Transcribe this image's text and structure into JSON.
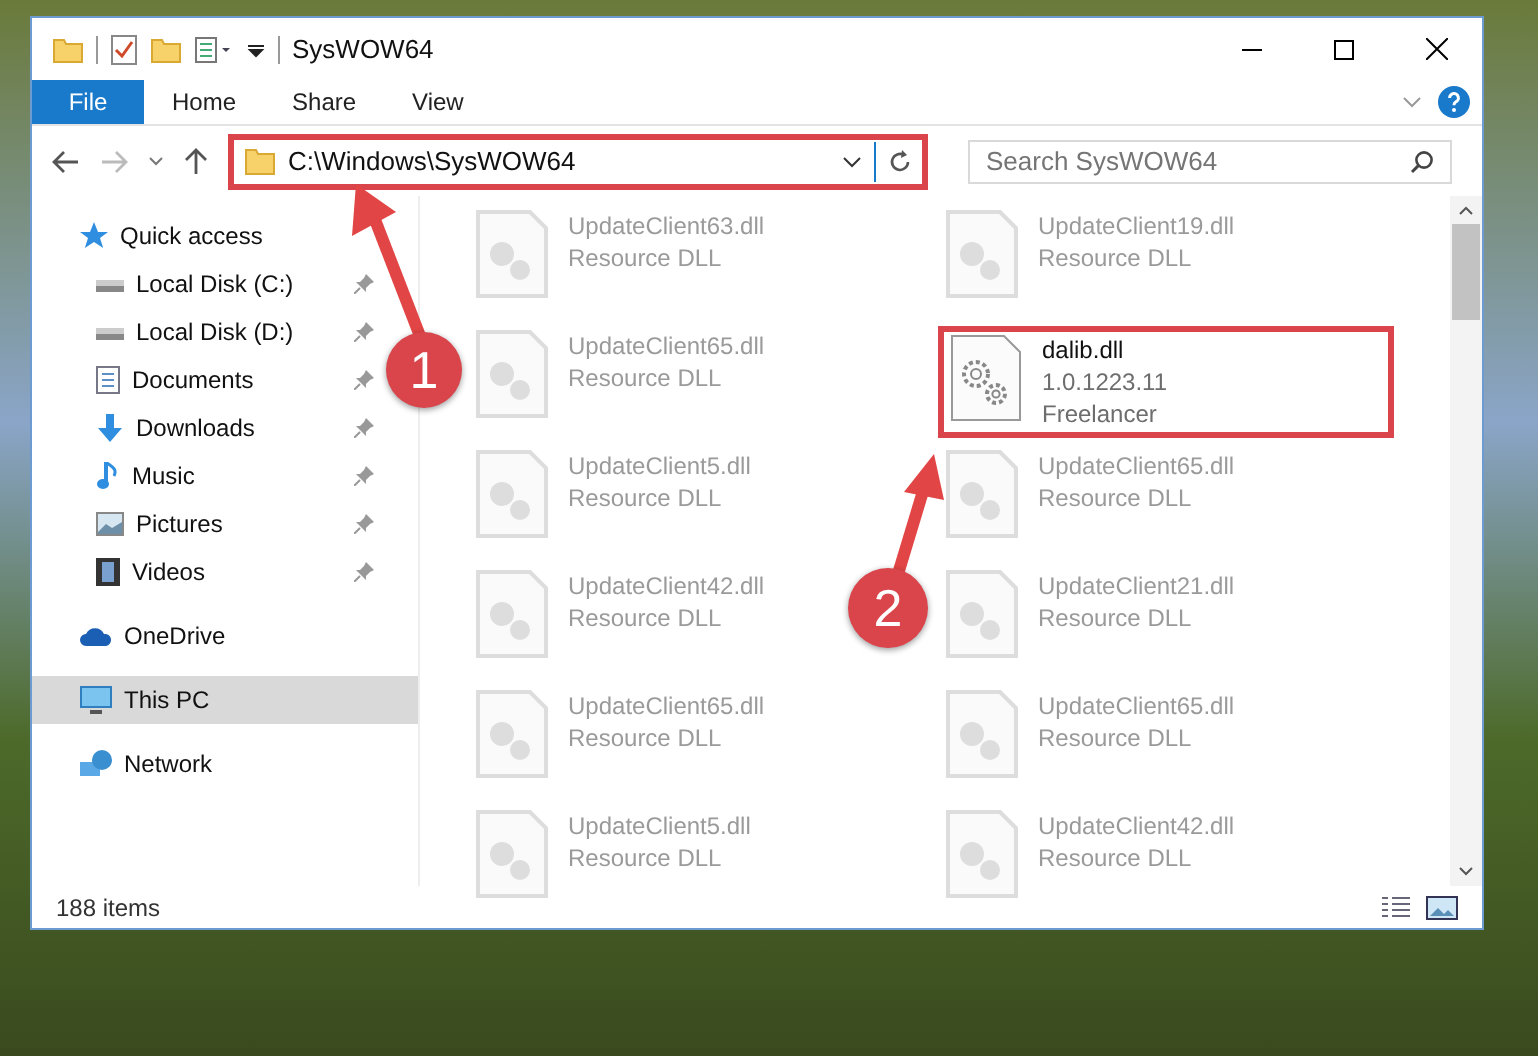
{
  "window": {
    "title": "SysWOW64"
  },
  "ribbon_tabs": [
    {
      "label": "File",
      "selected": true
    },
    {
      "label": "Home",
      "selected": false
    },
    {
      "label": "Share",
      "selected": false
    },
    {
      "label": "View",
      "selected": false
    }
  ],
  "address": {
    "path": "C:\\Windows\\SysWOW64",
    "highlighted": true
  },
  "search": {
    "placeholder": "Search SysWOW64"
  },
  "sidebar": {
    "items": [
      {
        "label": "Quick access",
        "selected": false,
        "children": [
          {
            "label": "Local Disk (C:)",
            "pinned": true
          },
          {
            "label": "Local Disk (D:)",
            "pinned": true
          },
          {
            "label": "Documents",
            "pinned": true
          },
          {
            "label": "Downloads",
            "pinned": true
          },
          {
            "label": "Music",
            "pinned": true
          },
          {
            "label": "Pictures",
            "pinned": true
          },
          {
            "label": "Videos",
            "pinned": true
          }
        ]
      },
      {
        "label": "OneDrive",
        "selected": false
      },
      {
        "label": "This PC",
        "selected": true
      },
      {
        "label": "Network",
        "selected": false
      }
    ]
  },
  "files": [
    {
      "name": "UpdateClient63.dll",
      "details": [
        "Resource DLL"
      ],
      "kind": "resource",
      "highlighted": false
    },
    {
      "name": "UpdateClient19.dll",
      "details": [
        "Resource DLL"
      ],
      "kind": "resource",
      "highlighted": false
    },
    {
      "name": "UpdateClient65.dll",
      "details": [
        "Resource DLL"
      ],
      "kind": "resource",
      "highlighted": false
    },
    {
      "name": "dalib.dll",
      "details": [
        "1.0.1223.11",
        "Freelancer"
      ],
      "kind": "gears",
      "highlighted": true
    },
    {
      "name": "UpdateClient5.dll",
      "details": [
        "Resource DLL"
      ],
      "kind": "resource",
      "highlighted": false
    },
    {
      "name": "UpdateClient65.dll",
      "details": [
        "Resource DLL"
      ],
      "kind": "resource",
      "highlighted": false
    },
    {
      "name": "UpdateClient42.dll",
      "details": [
        "Resource DLL"
      ],
      "kind": "resource",
      "highlighted": false
    },
    {
      "name": "UpdateClient21.dll",
      "details": [
        "Resource DLL"
      ],
      "kind": "resource",
      "highlighted": false
    },
    {
      "name": "UpdateClient65.dll",
      "details": [
        "Resource DLL"
      ],
      "kind": "resource",
      "highlighted": false
    },
    {
      "name": "UpdateClient65.dll",
      "details": [
        "Resource DLL"
      ],
      "kind": "resource",
      "highlighted": false
    },
    {
      "name": "UpdateClient5.dll",
      "details": [
        "Resource DLL"
      ],
      "kind": "resource",
      "highlighted": false
    },
    {
      "name": "UpdateClient42.dll",
      "details": [
        "Resource DLL"
      ],
      "kind": "resource",
      "highlighted": false
    }
  ],
  "status_bar": {
    "item_count": "188 items"
  },
  "annotations": [
    {
      "number": "1"
    },
    {
      "number": "2"
    }
  ]
}
